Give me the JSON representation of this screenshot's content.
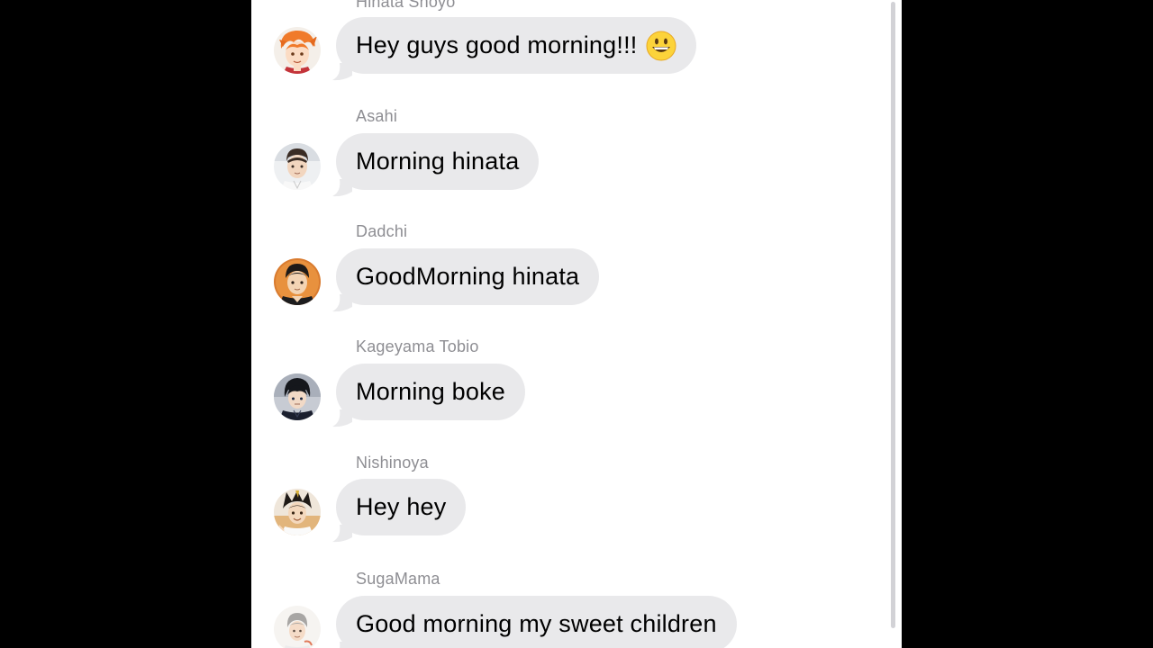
{
  "colors": {
    "background": "#000000",
    "screen": "#ffffff",
    "bubble": "#e9e9eb",
    "sender_name": "#8e8e93",
    "text": "#000000"
  },
  "messages": [
    {
      "sender": "Hinata Shoyo",
      "text": "Hey guys good morning!!!",
      "emoji": "grinning-face-emoji",
      "avatar": "hinata-avatar"
    },
    {
      "sender": "Asahi",
      "text": "Morning hinata",
      "avatar": "asahi-avatar"
    },
    {
      "sender": "Dadchi",
      "text": "GoodMorning hinata",
      "avatar": "dadchi-avatar"
    },
    {
      "sender": "Kageyama Tobio",
      "text": "Morning boke",
      "avatar": "kageyama-avatar"
    },
    {
      "sender": "Nishinoya",
      "text": "Hey hey",
      "avatar": "nishinoya-avatar"
    },
    {
      "sender": "SugaMama",
      "text": "Good morning my sweet children",
      "avatar": "suga-avatar"
    }
  ]
}
